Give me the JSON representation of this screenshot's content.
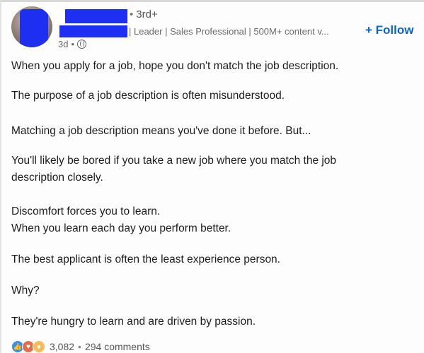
{
  "post": {
    "author": {
      "degree": "3rd+",
      "headline": "| Leader | Sales Professional | 500M+ content v...",
      "time": "3d",
      "visibility_icon": "globe-icon"
    },
    "follow_label": "+ Follow",
    "paragraphs": [
      "When you apply for a job, hope you don't match the job description.",
      "The purpose of a job description is often misunderstood.",
      "Matching a job description means you've done it before. But...",
      "You'll likely be bored if you take a new job where you match the job",
      "description closely.",
      "Discomfort forces you to learn.",
      "When you learn each day you perform better.",
      "The best applicant is often the least experience person.",
      "Why?",
      "They're hungry to learn and are driven by passion."
    ],
    "social": {
      "reaction_icons": [
        "like-icon",
        "love-icon",
        "insightful-icon"
      ],
      "reactions_count": "3,082",
      "comments": "294 comments"
    }
  },
  "colors": {
    "accent": "#0a66c2",
    "redaction": "#1f2ff2"
  }
}
